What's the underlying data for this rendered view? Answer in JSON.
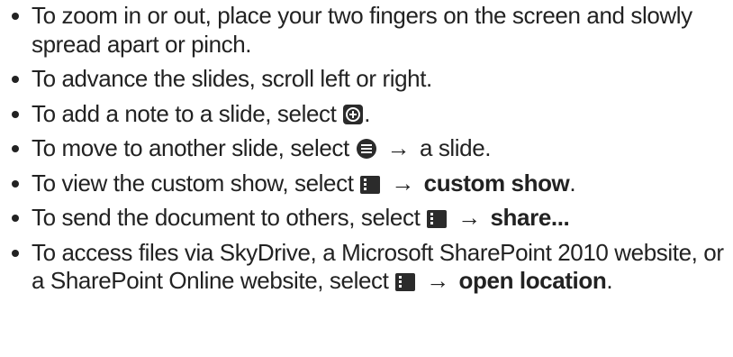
{
  "bullets": [
    {
      "text": "To zoom in or out, place your two fingers on the screen and slowly spread apart or pinch."
    },
    {
      "text": "To advance the slides, scroll left or right."
    },
    {
      "pre": "To add a note to a slide, select",
      "post": ".",
      "icon": "add-note-icon"
    },
    {
      "pre": "To move to another slide, select",
      "arrow": "→",
      "post": "a slide.",
      "icon": "slide-list-icon"
    },
    {
      "pre": "To view the custom show, select",
      "arrow": "→",
      "bold": "custom show",
      "post": ".",
      "icon": "menu-icon"
    },
    {
      "pre": "To send the document to others, select",
      "arrow": "→",
      "bold": "share...",
      "icon": "menu-icon"
    },
    {
      "pre": "To access files via SkyDrive, a Microsoft SharePoint 2010 website, or a SharePoint Online website, select",
      "arrow": "→",
      "bold": "open location",
      "post": ".",
      "icon": "menu-icon"
    }
  ],
  "colors": {
    "text": "#222222",
    "icon_bg": "#2b2b2b"
  }
}
